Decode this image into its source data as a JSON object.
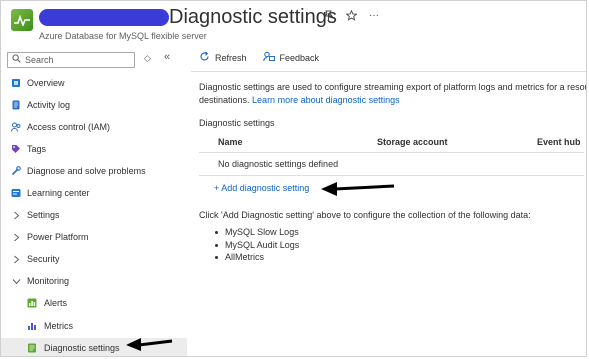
{
  "header": {
    "title": "Diagnostic settings",
    "subtitle": "Azure Database for MySQL flexible server",
    "pin_icon": "pin-icon",
    "star_icon": "star-icon",
    "more_label": "···"
  },
  "sidebar": {
    "search_placeholder": "Search",
    "collapse_a": "◇",
    "collapse_b": "«",
    "items": [
      {
        "label": "Overview",
        "icon": "overview-icon"
      },
      {
        "label": "Activity log",
        "icon": "activity-log-icon"
      },
      {
        "label": "Access control (IAM)",
        "icon": "people-icon"
      },
      {
        "label": "Tags",
        "icon": "tag-icon"
      },
      {
        "label": "Diagnose and solve problems",
        "icon": "wrench-icon"
      },
      {
        "label": "Learning center",
        "icon": "learning-icon"
      },
      {
        "label": "Settings",
        "icon": "chevron-right-icon"
      },
      {
        "label": "Power Platform",
        "icon": "chevron-right-icon"
      },
      {
        "label": "Security",
        "icon": "chevron-right-icon"
      },
      {
        "label": "Monitoring",
        "icon": "chevron-down-icon"
      },
      {
        "label": "Alerts",
        "icon": "alerts-icon"
      },
      {
        "label": "Metrics",
        "icon": "metrics-icon"
      },
      {
        "label": "Diagnostic settings",
        "icon": "diagnostic-icon"
      }
    ]
  },
  "toolbar": {
    "refresh_label": "Refresh",
    "feedback_label": "Feedback"
  },
  "main": {
    "description_line1": "Diagnostic settings are used to configure streaming export of platform logs and metrics for a resou",
    "description_line2_prefix": "destinations. ",
    "learn_more_link": "Learn more about diagnostic settings",
    "section_title": "Diagnostic settings",
    "columns": [
      "Name",
      "Storage account",
      "Event hub"
    ],
    "empty_message": "No diagnostic settings defined",
    "add_link": "+ Add diagnostic setting",
    "instructions": "Click 'Add Diagnostic setting' above to configure the collection of the following data:",
    "data_items": [
      "MySQL Slow Logs",
      "MySQL Audit Logs",
      "AllMetrics"
    ]
  },
  "colors": {
    "accent": "#0f62c4",
    "selected_bg": "#ececec",
    "redaction": "#3b3bd8",
    "icon_green": "#5ea82e"
  }
}
